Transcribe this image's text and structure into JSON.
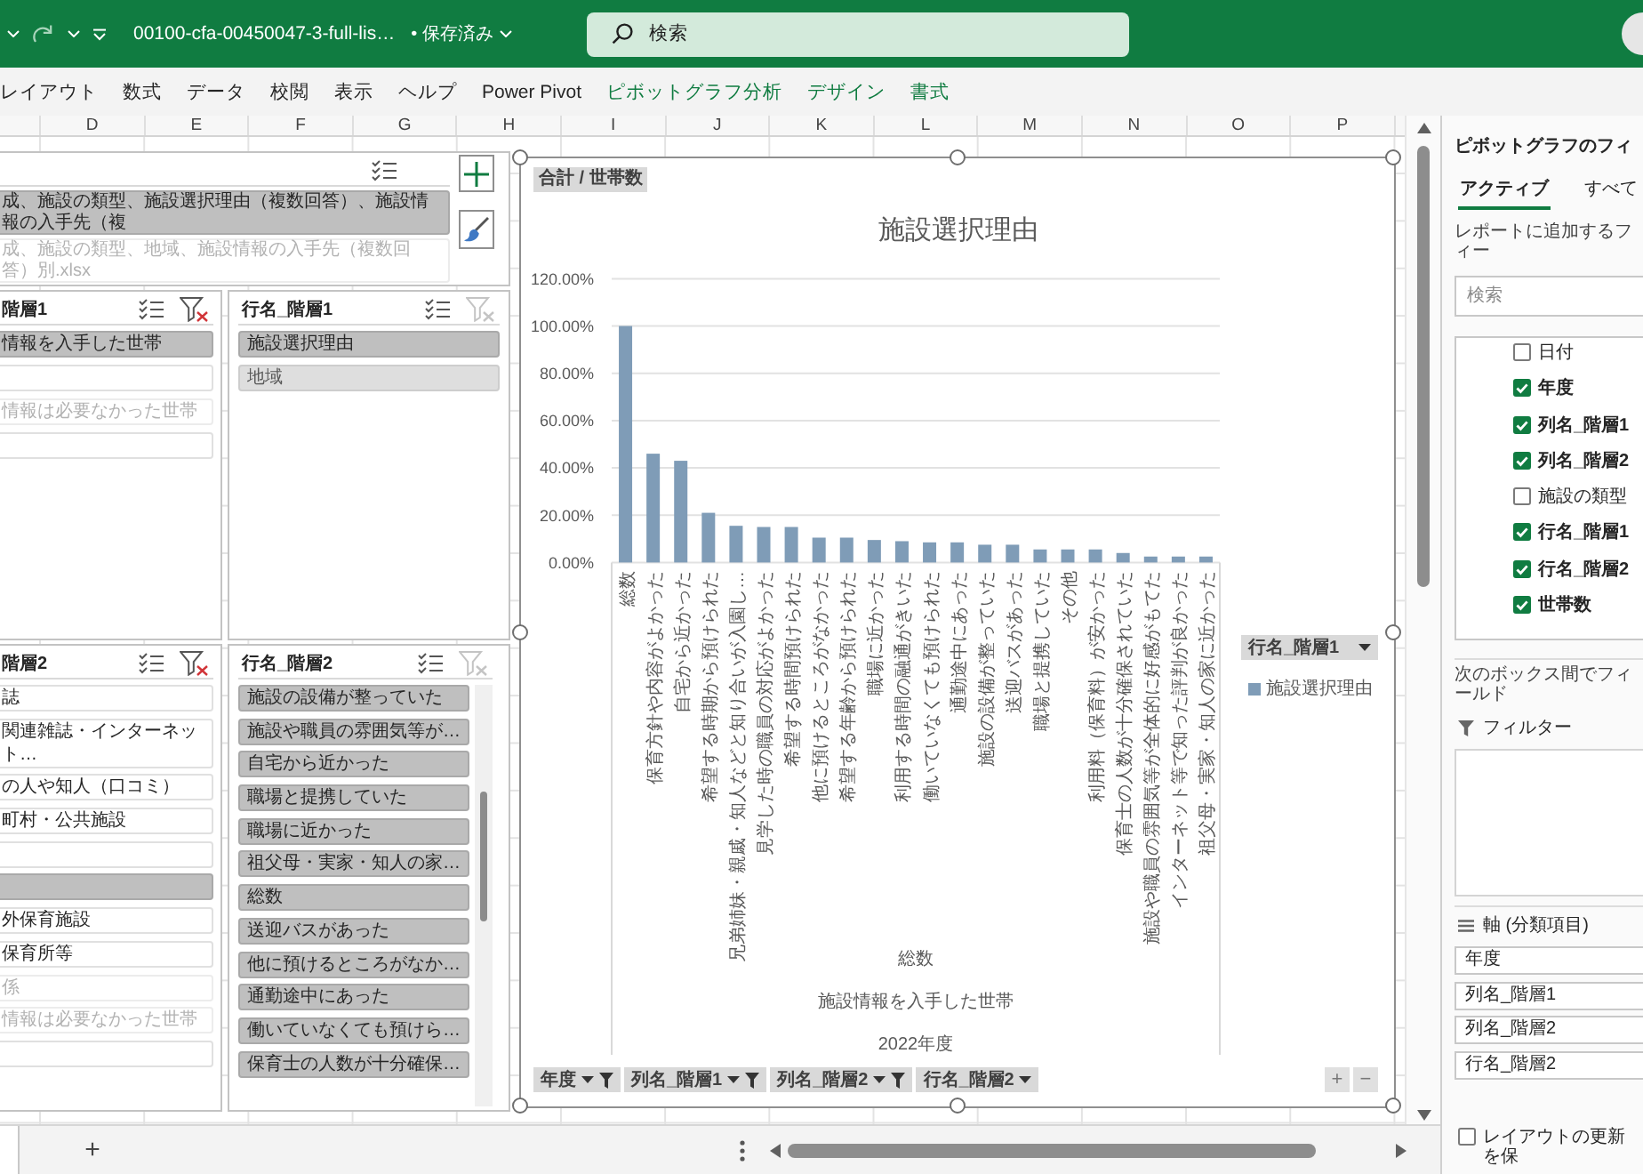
{
  "title_bar": {
    "file_name": "00100-cfa-00450047-3-full-lis…",
    "save_status": "• 保存済み",
    "search": {
      "placeholder": "検索"
    }
  },
  "ribbon_tabs": [
    {
      "label": "レイアウト",
      "contextual": false
    },
    {
      "label": "数式",
      "contextual": false
    },
    {
      "label": "データ",
      "contextual": false
    },
    {
      "label": "校閲",
      "contextual": false
    },
    {
      "label": "表示",
      "contextual": false
    },
    {
      "label": "ヘルプ",
      "contextual": false
    },
    {
      "label": "Power Pivot",
      "contextual": false
    },
    {
      "label": "ピボットグラフ分析",
      "contextual": true
    },
    {
      "label": "デザイン",
      "contextual": true
    },
    {
      "label": "書式",
      "contextual": true
    }
  ],
  "columns": [
    "D",
    "E",
    "F",
    "G",
    "H",
    "I",
    "J",
    "K",
    "L",
    "M",
    "N",
    "O",
    "P"
  ],
  "slicers": [
    {
      "items": [
        {
          "label": "成、施設の類型、施設選択理由（複数回答）、施設情報の入手先（複",
          "selected": true,
          "has_data": true
        },
        {
          "label": "成、施設の類型、地域、施設情報の入手先（複数回答）別.xlsx",
          "selected": false,
          "has_data": false
        }
      ]
    },
    {
      "title": "階層1",
      "filtered": true,
      "items": [
        {
          "label": "情報を入手した世帯",
          "selected": true,
          "has_data": true
        },
        {
          "selected": false,
          "has_data": true
        },
        {
          "label": "情報は必要なかった世帯",
          "selected": false,
          "has_data": false
        },
        {
          "selected": false,
          "has_data": true
        }
      ]
    },
    {
      "title": "行名_階層1",
      "filtered": false,
      "items": [
        {
          "label": "施設選択理由",
          "selected": true,
          "has_data": true
        },
        {
          "label": "地域",
          "selected": true,
          "has_data": false
        }
      ]
    },
    {
      "title": "階層2",
      "filtered": true,
      "items": [
        {
          "label": "誌",
          "selected": false,
          "has_data": true
        },
        {
          "label": "関連雑誌・インターネット…",
          "selected": false,
          "has_data": true
        },
        {
          "label": "の人や知人（口コミ）",
          "selected": false,
          "has_data": true
        },
        {
          "label": "町村・公共施設",
          "selected": false,
          "has_data": true
        },
        {
          "selected": false,
          "has_data": true
        },
        {
          "selected": true,
          "has_data": true
        },
        {
          "label": "外保育施設",
          "selected": false,
          "has_data": true
        },
        {
          "label": "保育所等",
          "selected": false,
          "has_data": true
        },
        {
          "label": "係",
          "selected": false,
          "has_data": false
        },
        {
          "label": "情報は必要なかった世帯",
          "selected": false,
          "has_data": false
        },
        {
          "selected": false,
          "has_data": true
        }
      ]
    },
    {
      "title": "行名_階層2",
      "filtered": false,
      "items": [
        {
          "label": "施設の設備が整っていた",
          "selected": true,
          "has_data": true
        },
        {
          "label": "施設や職員の雰囲気等が…",
          "selected": true,
          "has_data": true
        },
        {
          "label": "自宅から近かった",
          "selected": true,
          "has_data": true
        },
        {
          "label": "職場と提携していた",
          "selected": true,
          "has_data": true
        },
        {
          "label": "職場に近かった",
          "selected": true,
          "has_data": true
        },
        {
          "label": "祖父母・実家・知人の家…",
          "selected": true,
          "has_data": true
        },
        {
          "label": "総数",
          "selected": true,
          "has_data": true
        },
        {
          "label": "送迎バスがあった",
          "selected": true,
          "has_data": true
        },
        {
          "label": "他に預けるところがなか…",
          "selected": true,
          "has_data": true
        },
        {
          "label": "通勤途中にあった",
          "selected": true,
          "has_data": true
        },
        {
          "label": "働いていなくても預けら…",
          "selected": true,
          "has_data": true
        },
        {
          "label": "保育士の人数が十分確保…",
          "selected": true,
          "has_data": true
        }
      ]
    }
  ],
  "pivot_chart": {
    "value_button": "合計 / 世帯数",
    "chart_data": {
      "type": "bar",
      "title": "施設選択理由",
      "categories": [
        "総数",
        "保育方針や内容がよかった",
        "自宅から近かった",
        "希望する時期から預けられた",
        "兄弟姉妹・親戚・知人などと知り合いが入園し…",
        "見学した時の職員の対応がよかった",
        "希望する時間預けられた",
        "他に預けるところがなかった",
        "希望する年齢から預けられた",
        "職場に近かった",
        "利用する時間の融通がきいた",
        "働いていなくても預けられた",
        "通勤途中にあった",
        "施設の設備が整っていた",
        "送迎バスがあった",
        "職場と提携していた",
        "その他",
        "利用料（保育料）が安かった",
        "保育士の人数が十分確保されていた",
        "施設や職員の雰囲気等が全体的に好感がもてた",
        "インターネット等で知った評判が良かった",
        "祖父母・実家・知人の家に近かった"
      ],
      "series": [
        {
          "name": "施設選択理由",
          "color": "#7f9cb7",
          "values": [
            100,
            46,
            43,
            21,
            15.5,
            15,
            15,
            10.5,
            10.5,
            9.5,
            9,
            8.5,
            8.5,
            7.5,
            7.5,
            5.5,
            5.5,
            5.5,
            4,
            2.5,
            2.5,
            2.5
          ]
        }
      ],
      "ylim": [
        0,
        120
      ],
      "yticks": [
        {
          "value": 0,
          "label": "0.00%"
        },
        {
          "value": 20,
          "label": "20.00%"
        },
        {
          "value": 40,
          "label": "40.00%"
        },
        {
          "value": 60,
          "label": "60.00%"
        },
        {
          "value": 80,
          "label": "80.00%"
        },
        {
          "value": 100,
          "label": "100.00%"
        },
        {
          "value": 120,
          "label": "120.00%"
        }
      ],
      "grid": true
    },
    "category_groups": [
      "総数",
      "施設情報を入手した世帯",
      "2022年度"
    ],
    "legend_button": {
      "label": "行名_階層1",
      "filtered": false
    },
    "axis_buttons": [
      {
        "label": "年度",
        "filtered": true
      },
      {
        "label": "列名_階層1",
        "filtered": true
      },
      {
        "label": "列名_階層2",
        "filtered": true
      },
      {
        "label": "行名_階層2",
        "filtered": false
      }
    ],
    "zoom_buttons": [
      "+",
      "−"
    ]
  },
  "sheet_bar": {
    "add_sheet": "+"
  },
  "field_pane": {
    "title": "ピボットグラフのフィ",
    "tabs": [
      {
        "label": "アクティブ",
        "selected": true
      },
      {
        "label": "すべて",
        "selected": false
      }
    ],
    "prompt": "レポートに追加するフィー",
    "search": {
      "placeholder": "検索"
    },
    "fields": [
      {
        "label": "日付",
        "checked": false
      },
      {
        "label": "年度",
        "checked": true
      },
      {
        "label": "列名_階層1",
        "checked": true
      },
      {
        "label": "列名_階層2",
        "checked": true
      },
      {
        "label": "施設の類型",
        "checked": false
      },
      {
        "label": "行名_階層1",
        "checked": true
      },
      {
        "label": "行名_階層2",
        "checked": true
      },
      {
        "label": "世帯数",
        "checked": true
      }
    ],
    "drag_hint": "次のボックス間でフィールド",
    "filter_area": {
      "label": "フィルター"
    },
    "axis_area": {
      "label": "軸 (分類項目)",
      "items": [
        "年度",
        "列名_階層1",
        "列名_階層2",
        "行名_階層2"
      ]
    },
    "defer_update": {
      "label": "レイアウトの更新を保",
      "checked": false
    }
  }
}
